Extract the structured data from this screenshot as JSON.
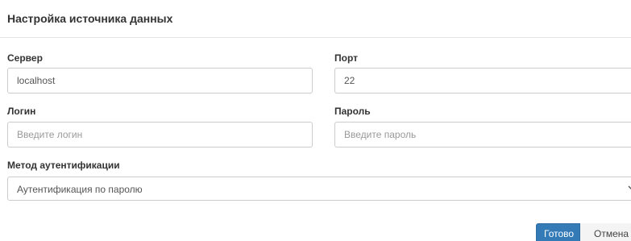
{
  "dialog": {
    "title": "Настройка источника данных"
  },
  "form": {
    "server": {
      "label": "Сервер",
      "value": "localhost",
      "placeholder": ""
    },
    "port": {
      "label": "Порт",
      "value": "22",
      "placeholder": ""
    },
    "login": {
      "label": "Логин",
      "value": "",
      "placeholder": "Введите логин"
    },
    "password": {
      "label": "Пароль",
      "value": "",
      "placeholder": "Введите пароль"
    },
    "auth_method": {
      "label": "Метод аутентификации",
      "selected": "Аутентификация по паролю"
    }
  },
  "footer": {
    "ok_label": "Готово",
    "cancel_label": "Отмена"
  },
  "icons": {
    "select_arrow": "chevron-down-icon"
  },
  "colors": {
    "primary": "#337ab7",
    "border": "#cccccc"
  }
}
